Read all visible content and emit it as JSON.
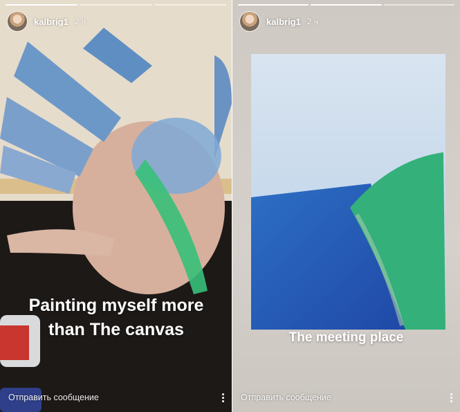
{
  "stories": [
    {
      "username": "kalbrig1",
      "time": "2 ч",
      "caption": "Painting myself more than The canvas",
      "reply_placeholder": "Отправить сообщение"
    },
    {
      "username": "kalbrig1",
      "time": "2 ч",
      "caption": "The meeting place",
      "reply_placeholder": "Отправить сообщение"
    }
  ],
  "icons": {
    "more": "more-vertical-icon"
  }
}
